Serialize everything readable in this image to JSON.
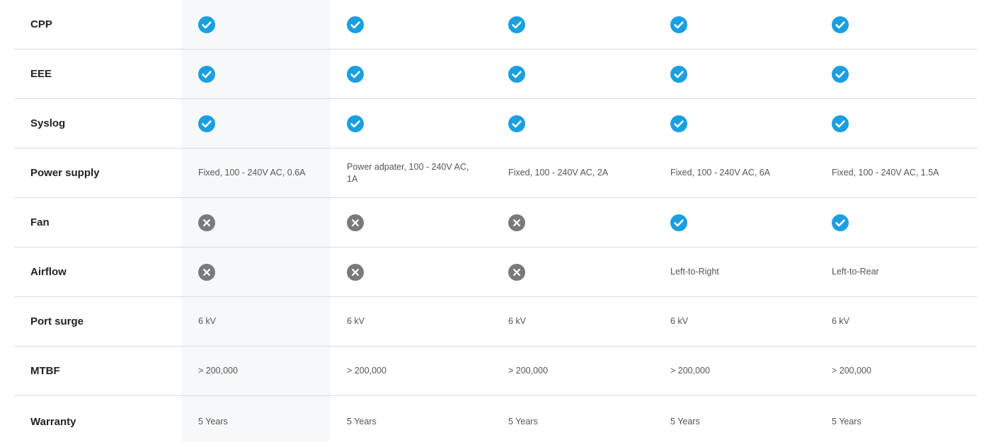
{
  "colors": {
    "check": "#1a9fe0",
    "cross": "#7a7a7a",
    "highlight": "#f7f8f9",
    "divider": "#dcdcdc"
  },
  "rows": [
    {
      "label": "CPP",
      "cells": [
        {
          "icon": "check-icon"
        },
        {
          "icon": "check-icon"
        },
        {
          "icon": "check-icon"
        },
        {
          "icon": "check-icon"
        },
        {
          "icon": "check-icon"
        }
      ]
    },
    {
      "label": "EEE",
      "cells": [
        {
          "icon": "check-icon"
        },
        {
          "icon": "check-icon"
        },
        {
          "icon": "check-icon"
        },
        {
          "icon": "check-icon"
        },
        {
          "icon": "check-icon"
        }
      ]
    },
    {
      "label": "Syslog",
      "cells": [
        {
          "icon": "check-icon"
        },
        {
          "icon": "check-icon"
        },
        {
          "icon": "check-icon"
        },
        {
          "icon": "check-icon"
        },
        {
          "icon": "check-icon"
        }
      ]
    },
    {
      "label": "Power supply",
      "cells": [
        {
          "text": "Fixed, 100 - 240V AC, 0.6A"
        },
        {
          "text": "Power adpater, 100 - 240V AC, 1A"
        },
        {
          "text": "Fixed, 100 - 240V AC, 2A"
        },
        {
          "text": "Fixed, 100 - 240V AC, 6A"
        },
        {
          "text": "Fixed, 100 - 240V AC, 1.5A"
        }
      ]
    },
    {
      "label": "Fan",
      "cells": [
        {
          "icon": "cross-icon"
        },
        {
          "icon": "cross-icon"
        },
        {
          "icon": "cross-icon"
        },
        {
          "icon": "check-icon"
        },
        {
          "icon": "check-icon"
        }
      ]
    },
    {
      "label": "Airflow",
      "cells": [
        {
          "icon": "cross-icon"
        },
        {
          "icon": "cross-icon"
        },
        {
          "icon": "cross-icon"
        },
        {
          "text": "Left-to-Right"
        },
        {
          "text": "Left-to-Rear"
        }
      ]
    },
    {
      "label": "Port surge",
      "cells": [
        {
          "text": "6 kV"
        },
        {
          "text": "6 kV"
        },
        {
          "text": "6 kV"
        },
        {
          "text": "6 kV"
        },
        {
          "text": "6 kV"
        }
      ]
    },
    {
      "label": "MTBF",
      "cells": [
        {
          "text": "> 200,000"
        },
        {
          "text": "> 200,000"
        },
        {
          "text": "> 200,000"
        },
        {
          "text": "> 200,000"
        },
        {
          "text": "> 200,000"
        }
      ]
    },
    {
      "label": "Warranty",
      "cells": [
        {
          "text": "5 Years"
        },
        {
          "text": "5 Years"
        },
        {
          "text": "5 Years"
        },
        {
          "text": "5 Years"
        },
        {
          "text": "5 Years"
        }
      ]
    }
  ]
}
